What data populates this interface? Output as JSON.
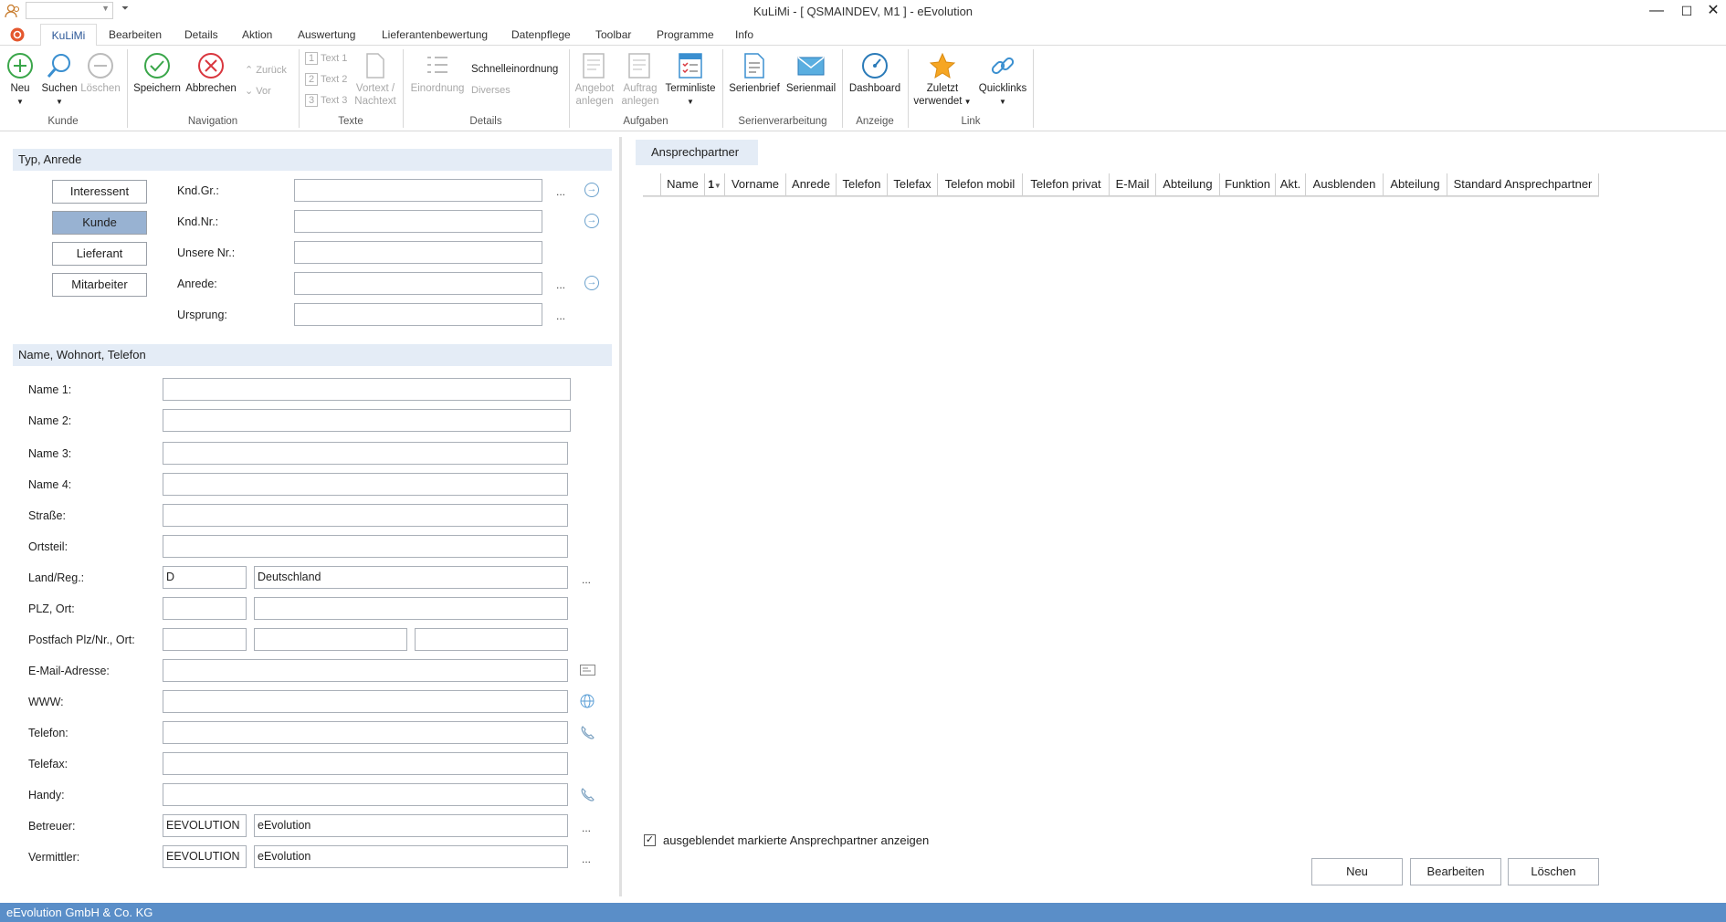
{
  "window": {
    "title": "KuLiMi - [ QSMAINDEV, M1 ]  -  eEvolution"
  },
  "tabs": [
    "KuLiMi",
    "Bearbeiten",
    "Details",
    "Aktion",
    "Auswertung",
    "Lieferantenbewertung",
    "Datenpflege",
    "Toolbar",
    "Programme",
    "Info"
  ],
  "ribbon": {
    "kunde": {
      "new": "Neu",
      "search": "Suchen",
      "delete": "Löschen",
      "group": "Kunde"
    },
    "navigation": {
      "save": "Speichern",
      "cancel": "Abbrechen",
      "back": "Zurück",
      "forward": "Vor",
      "group": "Navigation"
    },
    "texte": {
      "t1": "Text 1",
      "t2": "Text 2",
      "t3": "Text 3",
      "vortext1": "Vortext /",
      "vortext2": "Nachtext",
      "group": "Texte"
    },
    "details": {
      "einordnung": "Einordnung",
      "schnell": "Schnelleinordnung",
      "diverses": "Diverses",
      "group": "Details"
    },
    "aufgaben": {
      "angebot1": "Angebot",
      "angebot2": "anlegen",
      "auftrag1": "Auftrag",
      "auftrag2": "anlegen",
      "termin": "Terminliste",
      "group": "Aufgaben"
    },
    "serien": {
      "brief": "Serienbrief",
      "mail": "Serienmail",
      "group": "Serienverarbeitung"
    },
    "anzeige": {
      "dashboard": "Dashboard",
      "group": "Anzeige"
    },
    "link": {
      "zuletzt1": "Zuletzt",
      "zuletzt2": "verwendet",
      "quicklinks": "Quicklinks",
      "group": "Link"
    }
  },
  "typ": {
    "header": "Typ, Anrede",
    "buttons": [
      "Interessent",
      "Kunde",
      "Lieferant",
      "Mitarbeiter"
    ],
    "labels": [
      "Knd.Gr.:",
      "Knd.Nr.:",
      "Unsere Nr.:",
      "Anrede:",
      "Ursprung:"
    ]
  },
  "name": {
    "header": "Name, Wohnort, Telefon",
    "labels": [
      "Name 1:",
      "Name 2:",
      "Name 3:",
      "Name 4:",
      "Straße:",
      "Ortsteil:",
      "Land/Reg.:",
      "PLZ, Ort:",
      "Postfach Plz/Nr., Ort:",
      "E-Mail-Adresse:",
      "WWW:",
      "Telefon:",
      "Telefax:",
      "Handy:",
      "Betreuer:",
      "Vermittler:"
    ],
    "land_code": "D",
    "land_name": "Deutschland",
    "betreuer_code": "EEVOLUTION",
    "betreuer_name": "eEvolution",
    "vermittler_code": "EEVOLUTION",
    "vermittler_name": "eEvolution"
  },
  "contacts": {
    "tab": "Ansprechpartner",
    "columns": [
      "Name",
      "1",
      "Vorname",
      "Anrede",
      "Telefon",
      "Telefax",
      "Telefon mobil",
      "Telefon privat",
      "E-Mail",
      "Abteilung",
      "Funktion",
      "Akt.",
      "Ausblenden",
      "Abteilung",
      "Standard Ansprechpartner"
    ],
    "show_hidden_label": "ausgeblendet markierte Ansprechpartner anzeigen",
    "show_hidden_checked": true,
    "buttons": {
      "new": "Neu",
      "edit": "Bearbeiten",
      "delete": "Löschen"
    }
  },
  "status": {
    "text": "eEvolution GmbH & Co. KG"
  }
}
